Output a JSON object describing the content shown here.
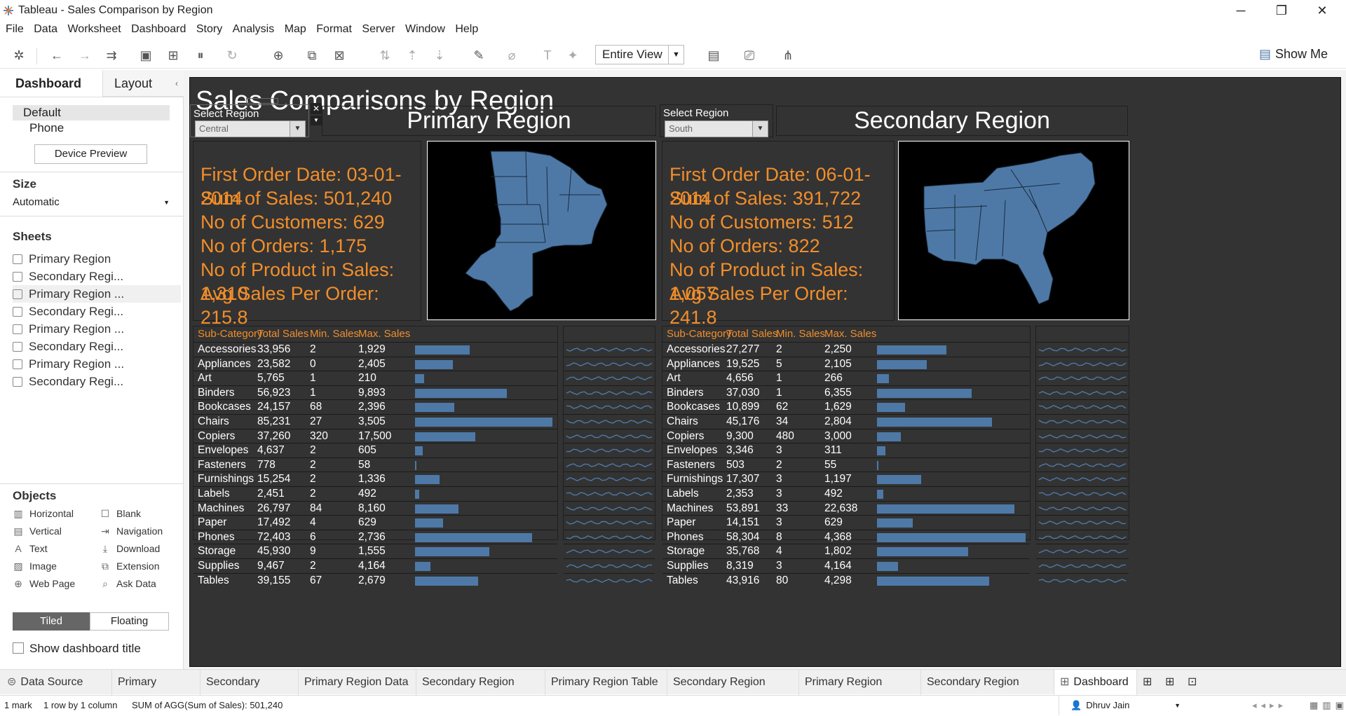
{
  "window": {
    "title": "Tableau - Sales Comparison by Region"
  },
  "menu": [
    "File",
    "Data",
    "Worksheet",
    "Dashboard",
    "Story",
    "Analysis",
    "Map",
    "Format",
    "Server",
    "Window",
    "Help"
  ],
  "toolbar": {
    "view_select": "Entire View",
    "show_me": "Show Me"
  },
  "left": {
    "tab_dashboard": "Dashboard",
    "tab_layout": "Layout",
    "device_default": "Default",
    "device_phone": "Phone",
    "device_preview": "Device Preview",
    "size_header": "Size",
    "size_value": "Automatic",
    "sheets_header": "Sheets",
    "sheets": [
      "Primary Region",
      "Secondary Regi...",
      "Primary Region ...",
      "Secondary Regi...",
      "Primary Region ...",
      "Secondary Regi...",
      "Primary Region ...",
      "Secondary Regi..."
    ],
    "objects_header": "Objects",
    "objects": [
      {
        "icon": "horizontal-icon",
        "label": "Horizontal"
      },
      {
        "icon": "blank-icon",
        "label": "Blank"
      },
      {
        "icon": "vertical-icon",
        "label": "Vertical"
      },
      {
        "icon": "navigation-icon",
        "label": "Navigation"
      },
      {
        "icon": "text-icon",
        "label": "Text"
      },
      {
        "icon": "download-icon",
        "label": "Download"
      },
      {
        "icon": "image-icon",
        "label": "Image"
      },
      {
        "icon": "extension-icon",
        "label": "Extension"
      },
      {
        "icon": "web-page-icon",
        "label": "Web Page"
      },
      {
        "icon": "ask-data-icon",
        "label": "Ask Data"
      }
    ],
    "tiled": "Tiled",
    "floating": "Floating",
    "show_title": "Show dashboard title"
  },
  "dashboard": {
    "title": "Sales Comparisons by Region",
    "primary": {
      "select_label": "Select Region",
      "select_value": "Central",
      "heading": "Primary Region",
      "kpis": [
        "First Order Date: 03-01-2014",
        "Sum of Sales: 501,240",
        "No of Customers: 629",
        "No of Orders: 1,175",
        "No of Product in Sales: 1,310",
        "Avg Sales Per Order: 215.8"
      ],
      "headers": [
        "Sub-Category",
        "Total Sales",
        "Min. Sales",
        "Max. Sales"
      ],
      "rows": [
        [
          "Accessories",
          "33,956",
          "2",
          "1,929"
        ],
        [
          "Appliances",
          "23,582",
          "0",
          "2,405"
        ],
        [
          "Art",
          "5,765",
          "1",
          "210"
        ],
        [
          "Binders",
          "56,923",
          "1",
          "9,893"
        ],
        [
          "Bookcases",
          "24,157",
          "68",
          "2,396"
        ],
        [
          "Chairs",
          "85,231",
          "27",
          "3,505"
        ],
        [
          "Copiers",
          "37,260",
          "320",
          "17,500"
        ],
        [
          "Envelopes",
          "4,637",
          "2",
          "605"
        ],
        [
          "Fasteners",
          "778",
          "2",
          "58"
        ],
        [
          "Furnishings",
          "15,254",
          "2",
          "1,336"
        ],
        [
          "Labels",
          "2,451",
          "2",
          "492"
        ],
        [
          "Machines",
          "26,797",
          "84",
          "8,160"
        ],
        [
          "Paper",
          "17,492",
          "4",
          "629"
        ],
        [
          "Phones",
          "72,403",
          "6",
          "2,736"
        ],
        [
          "Storage",
          "45,930",
          "9",
          "1,555"
        ],
        [
          "Supplies",
          "9,467",
          "2",
          "4,164"
        ],
        [
          "Tables",
          "39,155",
          "67",
          "2,679"
        ]
      ],
      "bar_values": [
        33956,
        23582,
        5765,
        56923,
        24157,
        85231,
        37260,
        4637,
        778,
        15254,
        2451,
        26797,
        17492,
        72403,
        45930,
        9467,
        39155
      ]
    },
    "secondary": {
      "select_label": "Select Region",
      "select_value": "South",
      "heading": "Secondary Region",
      "kpis": [
        "First Order Date: 06-01-2014",
        "Sum of Sales: 391,722",
        "No of Customers: 512",
        "No of Orders: 822",
        "No of Product in Sales: 1,057",
        "Avg Sales Per Order: 241.8"
      ],
      "headers": [
        "Sub-Category",
        "Total Sales",
        "Min. Sales",
        "Max. Sales"
      ],
      "rows": [
        [
          "Accessories",
          "27,277",
          "2",
          "2,250"
        ],
        [
          "Appliances",
          "19,525",
          "5",
          "2,105"
        ],
        [
          "Art",
          "4,656",
          "1",
          "266"
        ],
        [
          "Binders",
          "37,030",
          "1",
          "6,355"
        ],
        [
          "Bookcases",
          "10,899",
          "62",
          "1,629"
        ],
        [
          "Chairs",
          "45,176",
          "34",
          "2,804"
        ],
        [
          "Copiers",
          "9,300",
          "480",
          "3,000"
        ],
        [
          "Envelopes",
          "3,346",
          "3",
          "311"
        ],
        [
          "Fasteners",
          "503",
          "2",
          "55"
        ],
        [
          "Furnishings",
          "17,307",
          "3",
          "1,197"
        ],
        [
          "Labels",
          "2,353",
          "3",
          "492"
        ],
        [
          "Machines",
          "53,891",
          "33",
          "22,638"
        ],
        [
          "Paper",
          "14,151",
          "3",
          "629"
        ],
        [
          "Phones",
          "58,304",
          "8",
          "4,368"
        ],
        [
          "Storage",
          "35,768",
          "4",
          "1,802"
        ],
        [
          "Supplies",
          "8,319",
          "3",
          "4,164"
        ],
        [
          "Tables",
          "43,916",
          "80",
          "4,298"
        ]
      ],
      "bar_values": [
        27277,
        19525,
        4656,
        37030,
        10899,
        45176,
        9300,
        3346,
        503,
        17307,
        2353,
        53891,
        14151,
        58304,
        35768,
        8319,
        43916
      ]
    },
    "colors": {
      "accent": "#f28e2b",
      "bar": "#4e79a7",
      "background": "#333333"
    }
  },
  "tabs": [
    "Data Source",
    "Primary Region",
    "Secondary Region",
    "Primary Region Data",
    "Secondary Region Data",
    "Primary Region Table",
    "Secondary Region Table",
    "Primary Region Graph",
    "Secondary Region Graph",
    "Dashboard"
  ],
  "status": {
    "marks": "1 mark",
    "rows": "1 row by 1 column",
    "sum": "SUM of AGG(Sum of Sales): 501,240",
    "user": "Dhruv Jain"
  }
}
